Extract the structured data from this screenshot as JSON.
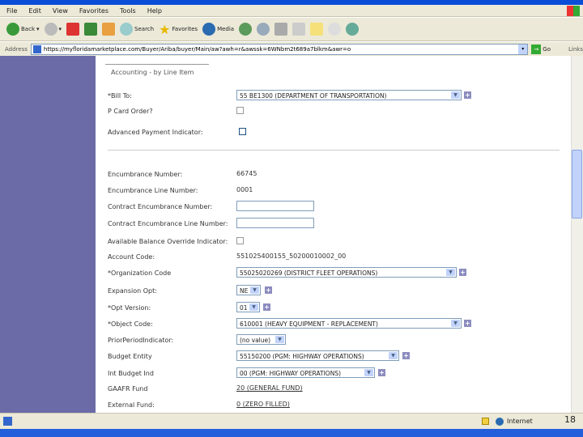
{
  "browser": {
    "menu": [
      "File",
      "Edit",
      "View",
      "Favorites",
      "Tools",
      "Help"
    ],
    "toolbar": {
      "back": "Back",
      "search": "Search",
      "favorites": "Favorites",
      "media": "Media"
    },
    "address_label": "Address",
    "url": "https://myfloridamarketplace.com/Buyer/Ariba/buyer/Main/aw?awh=r&awssk=6WNbm2t689a7blkm&awr=o",
    "go": "Go",
    "links": "Links",
    "status": {
      "zone": "Internet",
      "page_number": "18"
    }
  },
  "form": {
    "section_title": "Accounting - by Line Item",
    "bill_to": {
      "label": "*Bill To:",
      "value": "55 BE1300 (DEPARTMENT OF TRANSPORTATION)"
    },
    "pcard": {
      "label": "P Card Order?",
      "checked": false
    },
    "advanced_payment": {
      "label": "Advanced Payment Indicator:",
      "checked": false
    },
    "encumbrance_number": {
      "label": "Encumbrance Number:",
      "value": "66745"
    },
    "encumbrance_line": {
      "label": "Encumbrance Line Number:",
      "value": "0001"
    },
    "contract_enc_number": {
      "label": "Contract Encumbrance Number:",
      "value": ""
    },
    "contract_enc_line": {
      "label": "Contract Encumbrance Line Number:",
      "value": ""
    },
    "available_balance": {
      "label": "Available Balance Override Indicator:",
      "checked": false
    },
    "account_code": {
      "label": "Account Code:",
      "value": "551025400155_50200010002_00"
    },
    "organization_code": {
      "label": "*Organization Code",
      "value": "55025020269 (DISTRICT FLEET OPERATIONS)"
    },
    "expansion_opt": {
      "label": "Expansion Opt:",
      "value": "NE"
    },
    "opt_version": {
      "label": "*Opt Version:",
      "value": "01"
    },
    "object_code": {
      "label": "*Object Code:",
      "value": "610001 (HEAVY EQUIPMENT - REPLACEMENT)"
    },
    "prior_period": {
      "label": "PriorPeriodIndicator:",
      "value": "(no value)"
    },
    "budget_entity": {
      "label": "Budget Entity",
      "value": "55150200 (PGM: HIGHWAY OPERATIONS)"
    },
    "int_budget": {
      "label": "Int Budget Ind",
      "value": "00 (PGM: HIGHWAY OPERATIONS)"
    },
    "gaafr_fund": {
      "label": "GAAFR Fund",
      "value": "20 (GENERAL FUND)"
    },
    "external_fund": {
      "label": "External Fund:",
      "value": "0 (ZERO FILLED)"
    }
  },
  "colors": {
    "sidebar": "#6b6ba8",
    "titlebar": "#0a4ed8"
  }
}
